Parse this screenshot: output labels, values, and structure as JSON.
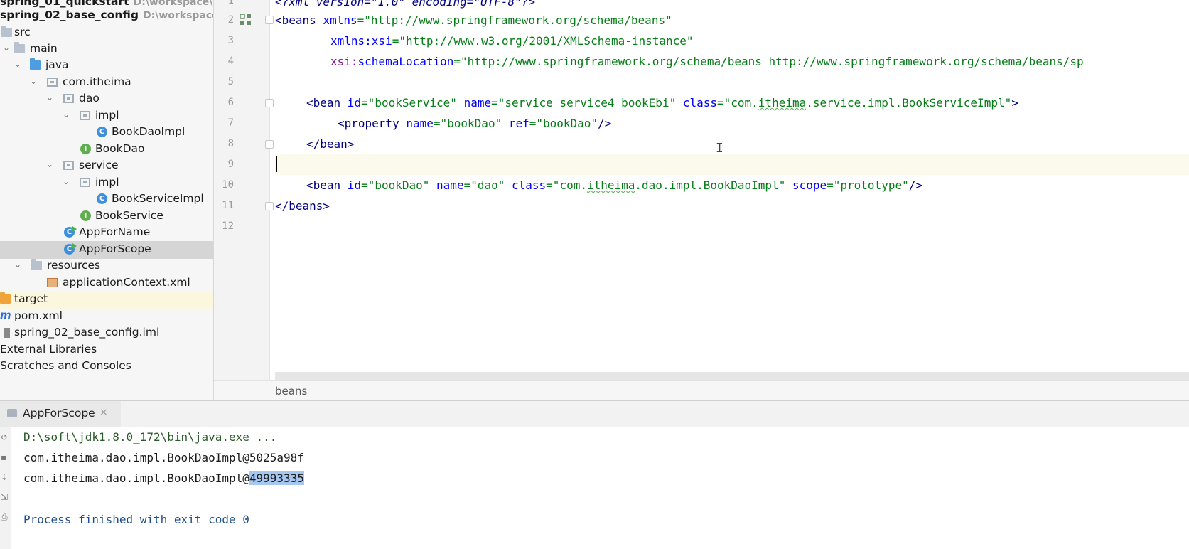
{
  "project": {
    "rows": [
      {
        "label": "spring_01_quickstart",
        "hint": "D:\\workspace\\sp"
      },
      {
        "label": "spring_02_base_config",
        "hint": "D:\\workspace\\s"
      },
      {
        "label": "src"
      },
      {
        "label": "main"
      },
      {
        "label": "java"
      },
      {
        "label": "com.itheima"
      },
      {
        "label": "dao"
      },
      {
        "label": "impl"
      },
      {
        "label": "BookDaoImpl"
      },
      {
        "label": "BookDao"
      },
      {
        "label": "service"
      },
      {
        "label": "impl"
      },
      {
        "label": "BookServiceImpl"
      },
      {
        "label": "BookService"
      },
      {
        "label": "AppForName"
      },
      {
        "label": "AppForScope"
      },
      {
        "label": "resources"
      },
      {
        "label": "applicationContext.xml"
      },
      {
        "label": "target"
      },
      {
        "label": "pom.xml"
      },
      {
        "label": "spring_02_base_config.iml"
      },
      {
        "label": "External Libraries"
      },
      {
        "label": "Scratches and Consoles"
      }
    ]
  },
  "editor": {
    "line_numbers": [
      "1",
      "2",
      "3",
      "4",
      "5",
      "6",
      "7",
      "8",
      "9",
      "10",
      "11",
      "12"
    ],
    "code": {
      "l1": "<?xml version=\"1.0\" encoding=\"UTF-8\"?>",
      "l2_open": "<beans",
      "l2_attr": " xmlns",
      "l2_eq": "=",
      "l2_val": "\"http://www.springframework.org/schema/beans\"",
      "l3_attr": "xmlns:xsi",
      "l3_eq": "=",
      "l3_val": "\"http://www.w3.org/2001/XMLSchema-instance\"",
      "l4_ns": "xsi:",
      "l4_attr": "schemaLocation",
      "l4_eq": "=",
      "l4_val": "\"http://www.springframework.org/schema/beans http://www.springframework.org/schema/beans/sp",
      "l6_tag": "<bean",
      "l6_a1": " id",
      "l6_v1": "=\"bookService\"",
      "l6_a2": " name",
      "l6_v2": "=\"service service4 bookEbi\"",
      "l6_a3": " class",
      "l6_v3a": "=\"com.",
      "l6_v3b": "itheima",
      "l6_v3c": ".service.impl.BookServiceImpl\"",
      "l6_end": ">",
      "l7_tag": "<property",
      "l7_a1": " name",
      "l7_v1": "=\"bookDao\"",
      "l7_a2": " ref",
      "l7_v2": "=\"bookDao\"",
      "l7_end": "/>",
      "l8": "</bean>",
      "l10_tag": "<bean",
      "l10_a1": " id",
      "l10_v1": "=\"bookDao\"",
      "l10_a2": " name",
      "l10_v2": "=\"dao\"",
      "l10_a3": " class",
      "l10_v3a": "=\"com.",
      "l10_v3b": "itheima",
      "l10_v3c": ".dao.impl.BookDaoImpl\"",
      "l10_a4": " scope",
      "l10_v4": "=\"prototype\"",
      "l10_end": "/>",
      "l11": "</beans>"
    },
    "breadcrumb": "beans",
    "cursor_glyph": "I"
  },
  "run": {
    "tab_label": "AppForScope",
    "tab_close": "×",
    "console": {
      "cmd": "D:\\soft\\jdk1.8.0_172\\bin\\java.exe ...",
      "out1": "com.itheima.dao.impl.BookDaoImpl@5025a98f",
      "out2_prefix": "com.itheima.dao.impl.BookDaoImpl@",
      "out2_selected": "49993335",
      "exit": "Process finished with exit code 0"
    }
  },
  "icons": {
    "folder": "folder-icon",
    "source_folder": "source-folder-icon",
    "package": "package-icon",
    "class": "class-icon",
    "interface": "interface-icon",
    "runnable_class": "runnable-class-icon",
    "xml_file": "xml-file-icon",
    "maven_file": "maven-icon",
    "module_file": "iml-file-icon"
  }
}
